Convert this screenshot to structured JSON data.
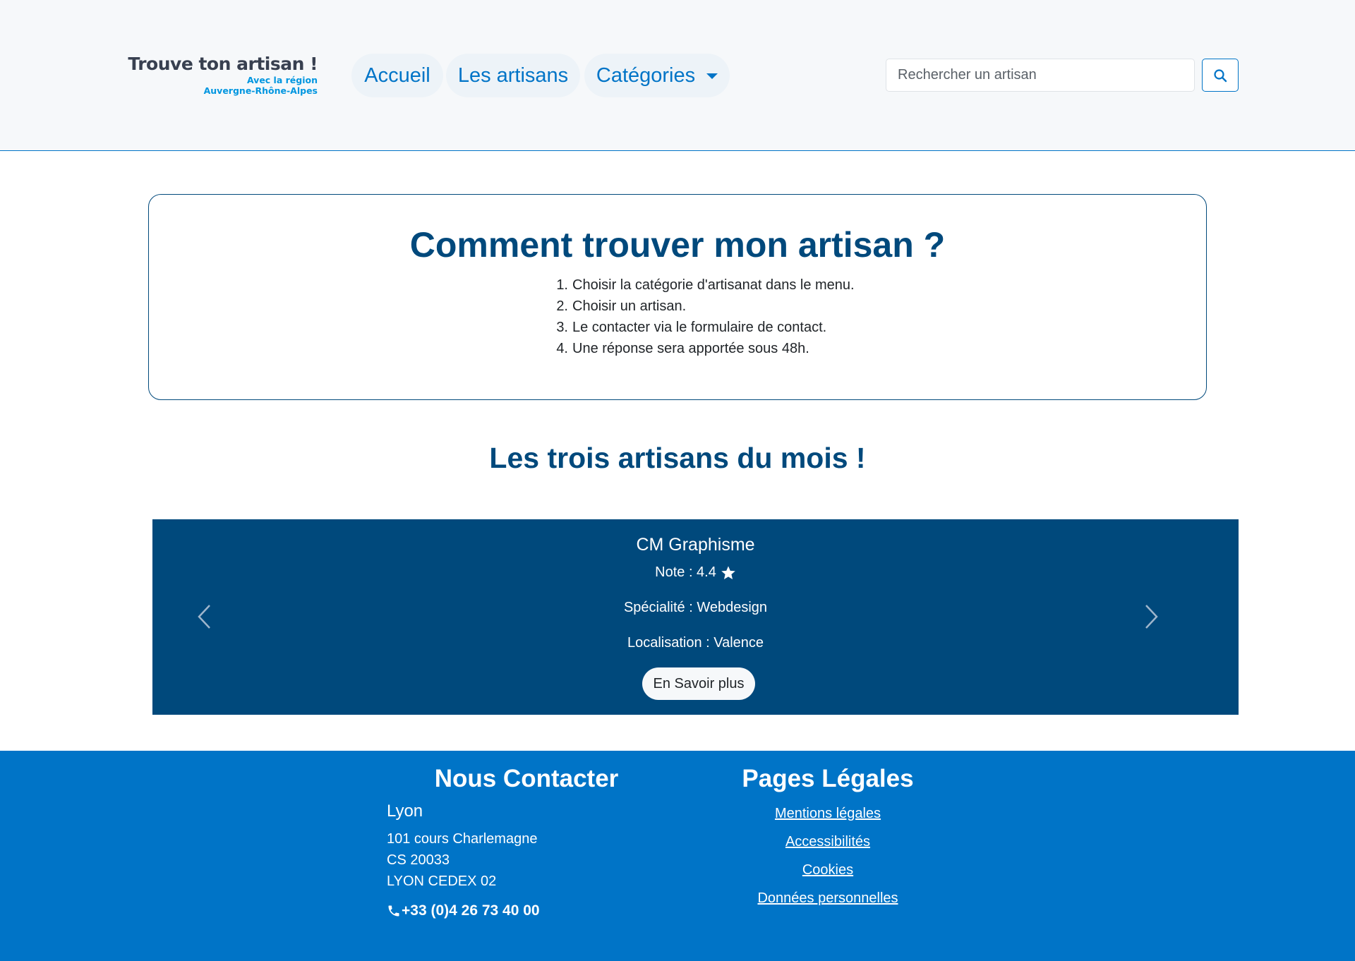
{
  "header": {
    "logo": {
      "title": "Trouve ton artisan !",
      "subtitle_line1": "Avec la région",
      "subtitle_line2": "Auvergne-Rhône-Alpes"
    },
    "nav": {
      "home": "Accueil",
      "artisans": "Les artisans",
      "categories": "Catégories"
    },
    "search": {
      "placeholder": "Rechercher un artisan",
      "button_icon": "search-icon"
    }
  },
  "intro": {
    "title": "Comment trouver mon artisan ?",
    "steps": [
      {
        "num": "1.",
        "text": "Choisir la catégorie d'artisanat dans le menu."
      },
      {
        "num": "2.",
        "text": "Choisir un artisan."
      },
      {
        "num": "3.",
        "text": "Le contacter via le formulaire de contact."
      },
      {
        "num": "4.",
        "text": "Une réponse sera apportée sous 48h."
      }
    ]
  },
  "featured": {
    "title": "Les trois artisans du mois !",
    "current": {
      "name": "CM Graphisme",
      "note": "Note : 4.4",
      "specialty": "Spécialité : Webdesign",
      "location": "Localisation : Valence",
      "button": "En Savoir plus"
    },
    "prev_icon": "chevron-left-icon",
    "next_icon": "chevron-right-icon"
  },
  "footer": {
    "contact": {
      "title": "Nous Contacter",
      "city": "Lyon",
      "address_lines": [
        "101 cours Charlemagne",
        "CS 20033",
        "LYON CEDEX 02"
      ],
      "phone": "+33 (0)4 26 73 40 00"
    },
    "legal": {
      "title": "Pages Légales",
      "links": [
        "Mentions légales",
        "Accessibilités",
        "Cookies",
        "Données personnelles"
      ]
    }
  },
  "colors": {
    "primary": "#0074c7",
    "dark_primary": "#00497c",
    "header_bg": "#f6f8fa",
    "logo_accent": "#0096e0"
  }
}
